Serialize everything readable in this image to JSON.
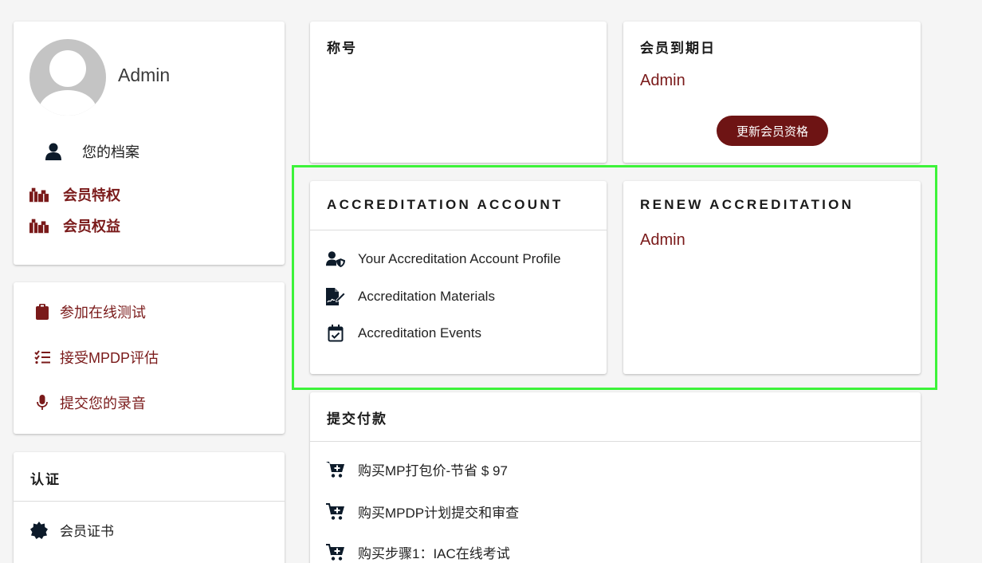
{
  "profile": {
    "name": "Admin",
    "items": [
      {
        "label": "您的档案",
        "icon": "user-icon"
      },
      {
        "label": "会员特权",
        "icon": "gifts-icon"
      },
      {
        "label": "会员权益",
        "icon": "gifts-icon"
      }
    ]
  },
  "actions": {
    "items": [
      {
        "label": "参加在线测试",
        "icon": "clipboard-icon"
      },
      {
        "label": "接受MPDP评估",
        "icon": "checklist-icon"
      },
      {
        "label": "提交您的录音",
        "icon": "microphone-icon"
      }
    ]
  },
  "certification": {
    "title": "认证",
    "items": [
      {
        "label": "会员证书",
        "icon": "certificate-icon"
      }
    ]
  },
  "title_card": {
    "title": "称号"
  },
  "expiry_card": {
    "title": "会员到期日",
    "value": "Admin",
    "button": "更新会员资格"
  },
  "accreditation_account": {
    "title": "ACCREDITATION ACCOUNT",
    "items": [
      {
        "label": "Your Accreditation Account Profile",
        "icon": "user-shield-icon"
      },
      {
        "label": "Accreditation Materials",
        "icon": "file-signature-icon"
      },
      {
        "label": "Accreditation Events",
        "icon": "calendar-check-icon"
      }
    ]
  },
  "renew_accreditation": {
    "title": "RENEW ACCREDITATION",
    "value": "Admin"
  },
  "payment": {
    "title": "提交付款",
    "items": [
      {
        "label": "购买MP打包价-节省 $ 97",
        "icon": "cart-plus-icon"
      },
      {
        "label": "购买MPDP计划提交和审查",
        "icon": "cart-plus-icon"
      },
      {
        "label": "购买步骤1：IAC在线考试",
        "icon": "cart-plus-icon"
      }
    ]
  },
  "colors": {
    "accent": "#7a1a1a",
    "button": "#6e1414",
    "highlight": "#3df33a"
  }
}
